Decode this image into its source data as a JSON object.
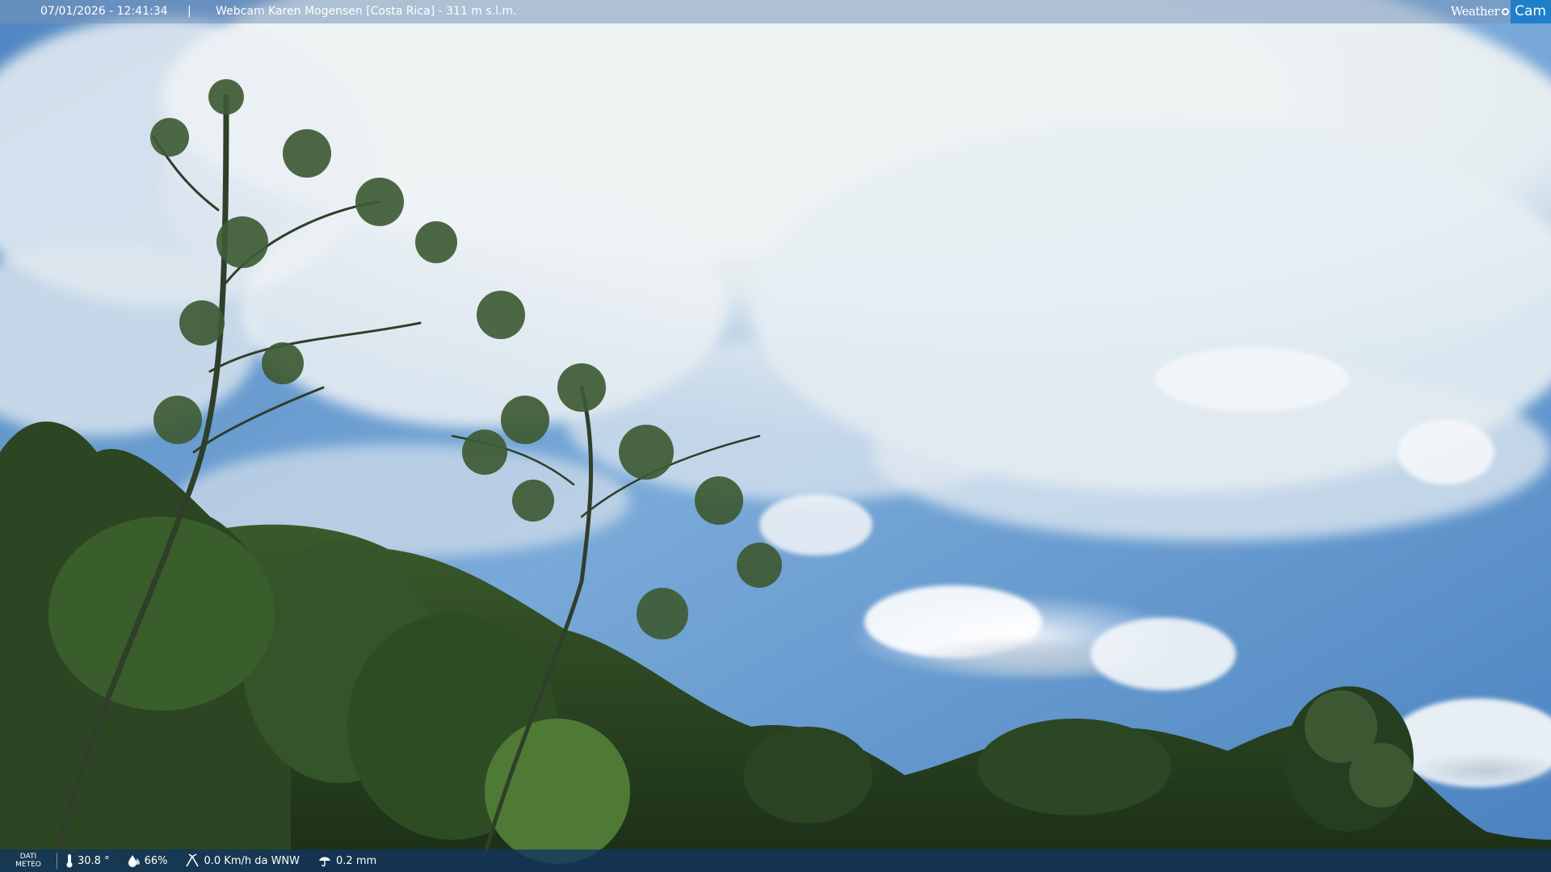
{
  "header": {
    "datetime": "07/01/2026 - 12:41:34",
    "separator": "|",
    "title": "Webcam Karen Mogensen [Costa Rica] - 311 m s.l.m."
  },
  "logo": {
    "word1": "Weather",
    "word2": "Cam",
    "accent_color": "#1f7fc9"
  },
  "weather": {
    "label_line1": "DATI",
    "label_line2": "METEO",
    "temperature": "30.8 °",
    "humidity": "66%",
    "wind": "0.0 Km/h da WNW",
    "rain": "0.2 mm",
    "icons": [
      "thermometer-icon",
      "humidity-drop-icon",
      "wind-icon",
      "rain-icon"
    ]
  }
}
